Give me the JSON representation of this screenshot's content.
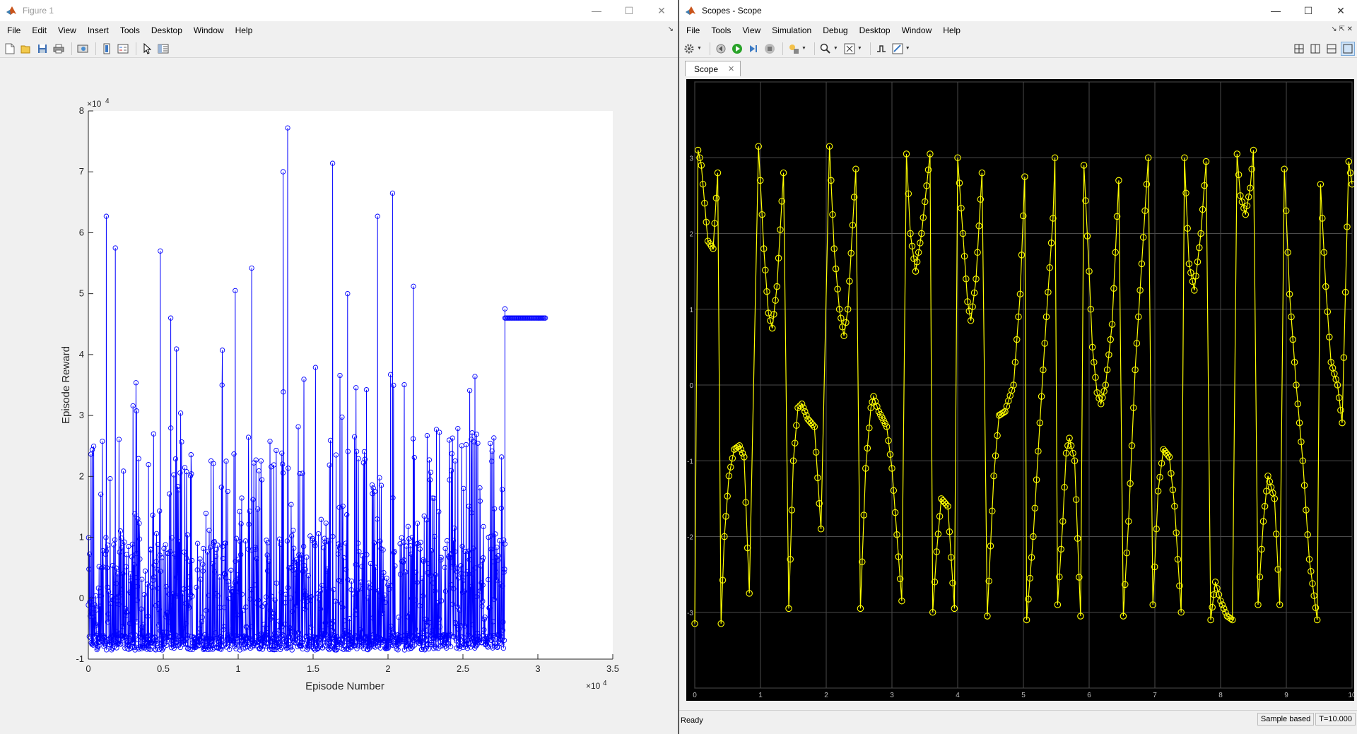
{
  "figure_window": {
    "title": "Figure 1",
    "menu": [
      "File",
      "Edit",
      "View",
      "Insert",
      "Tools",
      "Desktop",
      "Window",
      "Help"
    ],
    "toolbar_icons": [
      "new-figure-icon",
      "open-file-icon",
      "save-icon",
      "print-icon",
      "print-preview-icon",
      "colorbar-icon",
      "legend-icon",
      "pointer-icon",
      "property-inspector-icon"
    ],
    "window_controls": {
      "minimize": "—",
      "maximize": "☐",
      "close": "✕"
    }
  },
  "scope_window": {
    "title": "Scopes - Scope",
    "menu": [
      "File",
      "Tools",
      "View",
      "Simulation",
      "Debug",
      "Desktop",
      "Window",
      "Help"
    ],
    "tab_label": "Scope",
    "status": {
      "left": "Ready",
      "mode": "Sample based",
      "time": "T=10.000"
    },
    "window_controls": {
      "minimize": "—",
      "maximize": "☐",
      "close": "✕"
    }
  },
  "chart_data": [
    {
      "type": "line",
      "xlabel": "Episode Number",
      "ylabel": "Episode Reward",
      "x_exponent": "×10^4",
      "y_exponent": "×10^4",
      "xlim": [
        0,
        3.5
      ],
      "ylim": [
        -1,
        8
      ],
      "xticks": [
        "0",
        "0.5",
        "1",
        "1.5",
        "2",
        "2.5",
        "3",
        "3.5"
      ],
      "yticks": [
        "-1",
        "0",
        "1",
        "2",
        "3",
        "4",
        "5",
        "6",
        "7",
        "8"
      ],
      "marker": "circle",
      "color": "#0000ff",
      "series_note_region_spans": [
        {
          "x_start": 0.0,
          "x_end": 2.78,
          "baseline_min": -0.85,
          "baseline_max": -0.6
        },
        {
          "x_start": 2.78,
          "x_end": 3.05,
          "plateau": 4.6
        }
      ],
      "peaks": [
        {
          "x": 0.12,
          "y": 6.27
        },
        {
          "x": 0.18,
          "y": 5.75
        },
        {
          "x": 0.48,
          "y": 5.7
        },
        {
          "x": 0.55,
          "y": 4.6
        },
        {
          "x": 0.98,
          "y": 5.05
        },
        {
          "x": 1.09,
          "y": 5.42
        },
        {
          "x": 1.3,
          "y": 7.0
        },
        {
          "x": 1.33,
          "y": 7.72
        },
        {
          "x": 1.63,
          "y": 7.14
        },
        {
          "x": 1.73,
          "y": 5.0
        },
        {
          "x": 1.93,
          "y": 6.27
        },
        {
          "x": 2.03,
          "y": 6.65
        },
        {
          "x": 2.17,
          "y": 5.12
        },
        {
          "x": 2.58,
          "y": 3.64
        },
        {
          "x": 2.78,
          "y": 4.75
        }
      ]
    },
    {
      "type": "line",
      "xlim": [
        0,
        10
      ],
      "ylim": [
        -4,
        4
      ],
      "xticks": [
        "0",
        "1",
        "2",
        "3",
        "4",
        "5",
        "6",
        "7",
        "8",
        "9",
        "10"
      ],
      "yticks": [
        "-3",
        "-2",
        "-1",
        "0",
        "1",
        "2",
        "3"
      ],
      "marker": "circle",
      "color": "#ffff00",
      "grid": true,
      "series": [
        {
          "values": [
            [
              0,
              -3.15
            ],
            [
              0.05,
              3.1
            ],
            [
              0.1,
              2.9
            ],
            [
              0.15,
              2.4
            ],
            [
              0.2,
              1.9
            ],
            [
              0.28,
              1.8
            ],
            [
              0.35,
              2.8
            ],
            [
              0.4,
              -3.15
            ],
            [
              0.45,
              -2.0
            ],
            [
              0.52,
              -1.2
            ],
            [
              0.6,
              -0.85
            ],
            [
              0.68,
              -0.8
            ],
            [
              0.75,
              -0.95
            ],
            [
              0.83,
              -2.75
            ],
            [
              0.97,
              3.15
            ],
            [
              1.05,
              1.8
            ],
            [
              1.12,
              0.95
            ],
            [
              1.18,
              0.75
            ],
            [
              1.25,
              1.3
            ],
            [
              1.35,
              2.8
            ],
            [
              1.43,
              -2.95
            ],
            [
              1.5,
              -1.0
            ],
            [
              1.57,
              -0.3
            ],
            [
              1.63,
              -0.25
            ],
            [
              1.72,
              -0.45
            ],
            [
              1.82,
              -0.55
            ],
            [
              1.92,
              -1.9
            ],
            [
              2.05,
              3.15
            ],
            [
              2.12,
              1.8
            ],
            [
              2.2,
              1.0
            ],
            [
              2.27,
              0.65
            ],
            [
              2.33,
              1.0
            ],
            [
              2.45,
              2.85
            ],
            [
              2.52,
              -2.95
            ],
            [
              2.6,
              -1.1
            ],
            [
              2.68,
              -0.3
            ],
            [
              2.72,
              -0.15
            ],
            [
              2.8,
              -0.35
            ],
            [
              2.92,
              -0.55
            ],
            [
              3.0,
              -1.1
            ],
            [
              3.15,
              -2.85
            ],
            [
              3.22,
              3.05
            ],
            [
              3.28,
              2.0
            ],
            [
              3.36,
              1.5
            ],
            [
              3.45,
              2.0
            ],
            [
              3.58,
              3.05
            ],
            [
              3.62,
              -3.0
            ],
            [
              3.68,
              -2.2
            ],
            [
              3.75,
              -1.5
            ],
            [
              3.85,
              -1.6
            ],
            [
              3.95,
              -2.95
            ],
            [
              4.0,
              3.0
            ],
            [
              4.08,
              2.0
            ],
            [
              4.15,
              1.1
            ],
            [
              4.2,
              0.85
            ],
            [
              4.28,
              1.4
            ],
            [
              4.37,
              2.8
            ],
            [
              4.45,
              -3.05
            ],
            [
              4.55,
              -1.2
            ],
            [
              4.63,
              -0.4
            ],
            [
              4.72,
              -0.35
            ],
            [
              4.85,
              0.0
            ],
            [
              4.95,
              1.2
            ],
            [
              5.02,
              2.75
            ],
            [
              5.05,
              -3.1
            ],
            [
              5.15,
              -2.0
            ],
            [
              5.25,
              -0.5
            ],
            [
              5.35,
              0.9
            ],
            [
              5.45,
              2.2
            ],
            [
              5.48,
              3.0
            ],
            [
              5.52,
              -2.9
            ],
            [
              5.6,
              -1.8
            ],
            [
              5.65,
              -0.9
            ],
            [
              5.7,
              -0.7
            ],
            [
              5.78,
              -1.0
            ],
            [
              5.87,
              -3.05
            ],
            [
              5.92,
              2.9
            ],
            [
              6.0,
              1.5
            ],
            [
              6.05,
              0.5
            ],
            [
              6.12,
              -0.1
            ],
            [
              6.18,
              -0.25
            ],
            [
              6.25,
              0.0
            ],
            [
              6.35,
              0.8
            ],
            [
              6.45,
              2.7
            ],
            [
              6.52,
              -3.05
            ],
            [
              6.6,
              -1.8
            ],
            [
              6.7,
              0.2
            ],
            [
              6.8,
              1.6
            ],
            [
              6.9,
              3.0
            ],
            [
              6.97,
              -2.9
            ],
            [
              7.05,
              -1.4
            ],
            [
              7.13,
              -0.85
            ],
            [
              7.22,
              -0.95
            ],
            [
              7.3,
              -1.6
            ],
            [
              7.4,
              -3.0
            ],
            [
              7.45,
              3.0
            ],
            [
              7.52,
              1.6
            ],
            [
              7.6,
              1.25
            ],
            [
              7.7,
              2.0
            ],
            [
              7.78,
              2.95
            ],
            [
              7.85,
              -3.1
            ],
            [
              7.92,
              -2.6
            ],
            [
              8.0,
              -2.85
            ],
            [
              8.1,
              -3.05
            ],
            [
              8.18,
              -3.1
            ],
            [
              8.25,
              3.05
            ],
            [
              8.3,
              2.5
            ],
            [
              8.38,
              2.25
            ],
            [
              8.45,
              2.6
            ],
            [
              8.5,
              3.1
            ],
            [
              8.57,
              -2.9
            ],
            [
              8.65,
              -1.8
            ],
            [
              8.72,
              -1.2
            ],
            [
              8.82,
              -1.5
            ],
            [
              8.9,
              -2.9
            ],
            [
              8.97,
              2.85
            ],
            [
              9.05,
              1.2
            ],
            [
              9.15,
              0.0
            ],
            [
              9.25,
              -1.0
            ],
            [
              9.35,
              -2.3
            ],
            [
              9.47,
              -3.1
            ],
            [
              9.52,
              2.65
            ],
            [
              9.6,
              1.3
            ],
            [
              9.68,
              0.3
            ],
            [
              9.78,
              0.0
            ],
            [
              9.85,
              -0.5
            ],
            [
              9.95,
              2.95
            ],
            [
              10,
              2.65
            ]
          ]
        }
      ]
    }
  ]
}
